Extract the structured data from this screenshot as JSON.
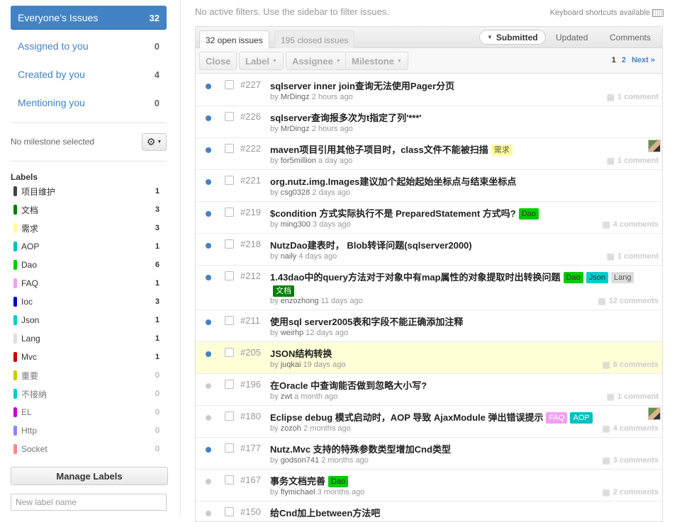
{
  "sidebar": {
    "filters": [
      {
        "label": "Everyone’s Issues",
        "count": "32"
      },
      {
        "label": "Assigned to you",
        "count": "0"
      },
      {
        "label": "Created by you",
        "count": "4"
      },
      {
        "label": "Mentioning you",
        "count": "0"
      }
    ],
    "milestone_label": "No milestone selected",
    "labels_title": "Labels",
    "labels": [
      {
        "name": "项目维护",
        "count": "1",
        "color": "#444444"
      },
      {
        "name": "文档",
        "count": "3",
        "color": "#008000"
      },
      {
        "name": "需求",
        "count": "3",
        "color": "#ffff99"
      },
      {
        "name": "AOP",
        "count": "1",
        "color": "#00c0c0"
      },
      {
        "name": "Dao",
        "count": "6",
        "color": "#00cc00"
      },
      {
        "name": "FAQ",
        "count": "1",
        "color": "#f0a0f0"
      },
      {
        "name": "Ioc",
        "count": "3",
        "color": "#0000cc"
      },
      {
        "name": "Json",
        "count": "1",
        "color": "#00cccc"
      },
      {
        "name": "Lang",
        "count": "1",
        "color": "#dddddd"
      },
      {
        "name": "Mvc",
        "count": "1",
        "color": "#cc0000"
      },
      {
        "name": "重要",
        "count": "0",
        "color": "#cccc00"
      },
      {
        "name": "不接纳",
        "count": "0",
        "color": "#00cccc"
      },
      {
        "name": "EL",
        "count": "0",
        "color": "#cc00cc"
      },
      {
        "name": "Http",
        "count": "0",
        "color": "#8888ff"
      },
      {
        "name": "Socket",
        "count": "0",
        "color": "#ff8888"
      }
    ],
    "manage_labels": "Manage Labels",
    "new_label_placeholder": "New label name"
  },
  "main": {
    "filter_message": "No active filters. Use the sidebar to filter issues.",
    "keyboard_hint": "Keyboard shortcuts available",
    "tabs": {
      "open": "32 open issues",
      "closed": "195 closed issues"
    },
    "sort": {
      "submitted": "Submitted",
      "updated": "Updated",
      "comments": "Comments"
    },
    "toolbar": {
      "close": "Close",
      "label": "Label",
      "assignee": "Assignee",
      "milestone": "Milestone"
    },
    "pager": {
      "current": "1",
      "page2": "2",
      "next": "Next »"
    },
    "issues": [
      {
        "number": "#227",
        "title": "sqlserver inner join查询无法使用Pager分页",
        "author": "MrDingz",
        "time": "2 hours ago",
        "comments": "1 comment"
      },
      {
        "number": "#226",
        "title": "sqlserver查询报多次为t指定了列'***'",
        "author": "MrDingz",
        "time": "2 hours ago",
        "comments": ""
      },
      {
        "number": "#222",
        "title": "maven项目引用其他子项目时，class文件不能被扫描",
        "author": "for5million",
        "time": "a day ago",
        "comments": "1 comment",
        "tags": [
          "需求"
        ]
      },
      {
        "number": "#221",
        "title": "org.nutz.img.Images建议加个起始起始坐标点与结束坐标点",
        "author": "csg0328",
        "time": "2 days ago",
        "comments": ""
      },
      {
        "number": "#219",
        "title": "$condition 方式实际执行不是 PreparedStatement 方式吗?",
        "author": "ming300",
        "time": "3 days ago",
        "comments": "4 comments",
        "tags": [
          "Dao"
        ]
      },
      {
        "number": "#218",
        "title": "NutzDao建表时， Blob转译问题(sqlserver2000)",
        "author": "naily",
        "time": "4 days ago",
        "comments": "1 comment"
      },
      {
        "number": "#212",
        "title": "1.43dao中的query方法对于对象中有map属性的对象提取时出转换问题",
        "author": "enzozhong",
        "time": "11 days ago",
        "comments": "12 comments",
        "tags": [
          "Dao",
          "Json",
          "Lang",
          "文档"
        ]
      },
      {
        "number": "#211",
        "title": "使用sql server2005表和字段不能正确添加注释",
        "author": "weirhp",
        "time": "12 days ago",
        "comments": ""
      },
      {
        "number": "#205",
        "title": "JSON结构转换",
        "author": "juqkai",
        "time": "19 days ago",
        "comments": "6 comments"
      },
      {
        "number": "#196",
        "title": "在Oracle 中查询能否做到忽略大小写?",
        "author": "zwt",
        "time": "a month ago",
        "comments": "1 comment"
      },
      {
        "number": "#180",
        "title": "Eclipse debug 模式启动时，AOP 导致 AjaxModule 弹出错误提示",
        "author": "zozoh",
        "time": "2 months ago",
        "comments": "4 comments",
        "tags": [
          "FAQ",
          "AOP"
        ]
      },
      {
        "number": "#177",
        "title": "Nutz.Mvc 支持的特殊参数类型增加Cnd类型",
        "author": "godson741",
        "time": "2 months ago",
        "comments": "3 comments"
      },
      {
        "number": "#167",
        "title": "事务文档完善",
        "author": "flymichael",
        "time": "3 months ago",
        "comments": "2 comments",
        "tags": [
          "Dao"
        ]
      },
      {
        "number": "#150",
        "title": "给Cnd加上between方法吧",
        "author": "",
        "time": "",
        "comments": ""
      }
    ]
  }
}
